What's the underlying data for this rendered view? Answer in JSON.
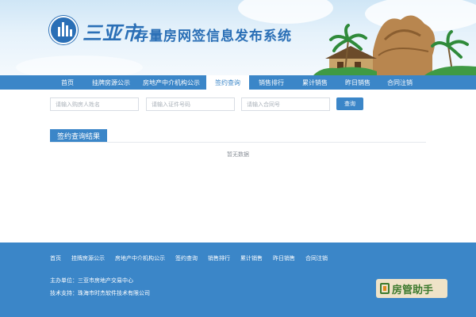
{
  "header": {
    "city_name": "三亚市",
    "system_title": "存量房网签信息发布系统"
  },
  "nav": {
    "items": [
      {
        "label": "首页"
      },
      {
        "label": "挂牌房源公示"
      },
      {
        "label": "房地产中介机构公示"
      },
      {
        "label": "签约查询",
        "active": true
      },
      {
        "label": "销售排行"
      },
      {
        "label": "累计销售"
      },
      {
        "label": "昨日销售"
      },
      {
        "label": "合同注销"
      }
    ]
  },
  "search": {
    "buyer_name_placeholder": "请输入购房人姓名",
    "id_number_placeholder": "请输入证件号码",
    "contract_no_placeholder": "请输入合同号",
    "button_label": "查询"
  },
  "results": {
    "title": "签约查询结果",
    "empty_text": "暂无数据"
  },
  "footer": {
    "links": [
      {
        "label": "首页"
      },
      {
        "label": "挂牌房源公示"
      },
      {
        "label": "房地产中介机构公示"
      },
      {
        "label": "签约查询"
      },
      {
        "label": "销售排行"
      },
      {
        "label": "累计销售"
      },
      {
        "label": "昨日销售"
      },
      {
        "label": "合同注销"
      }
    ],
    "organizer": "主办单位：三亚市房地产交易中心",
    "tech_support": "技术支持：珠海市时杰软件技术有限公司"
  },
  "watermark": {
    "text": "房管助手"
  },
  "colors": {
    "primary": "#3b86c8",
    "title_blue": "#2a6fb6",
    "footer_bg": "#3b86c8"
  },
  "icons": {
    "logo": "city-logo-icon",
    "watermark": "house-manager-icon"
  }
}
